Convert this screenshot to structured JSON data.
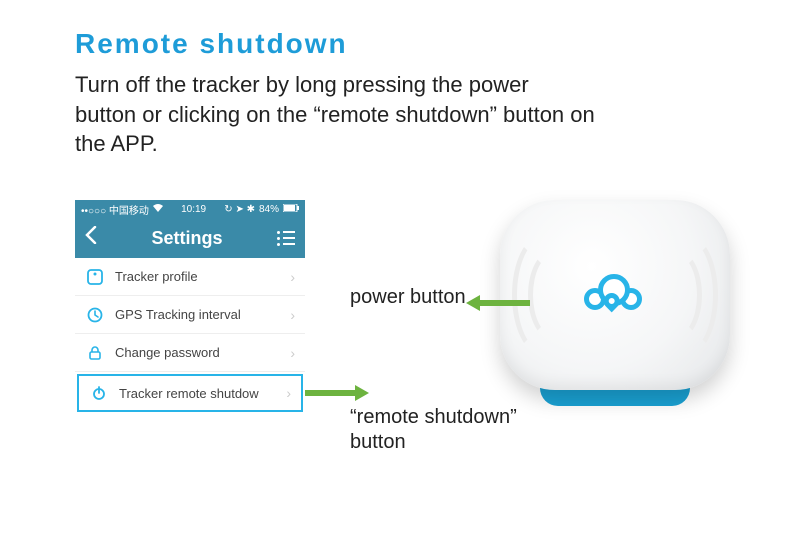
{
  "heading": "Remote shutdown",
  "description": "Turn off the tracker by long pressing the power button or clicking on the “remote shutdown” button on the APP.",
  "statusbar": {
    "carrier": "••○○○ 中国移动",
    "wifi_icon": "▲",
    "time": "10:19",
    "battery": "84%",
    "indicators": "↻ ➤ ✱"
  },
  "navbar": {
    "title": "Settings"
  },
  "rows": [
    {
      "label": "Tracker profile"
    },
    {
      "label": "GPS Tracking interval"
    },
    {
      "label": "Change password"
    },
    {
      "label": "Tracker remote shutdow"
    }
  ],
  "callouts": {
    "power": "power button",
    "remote": "“remote shutdown” button"
  }
}
